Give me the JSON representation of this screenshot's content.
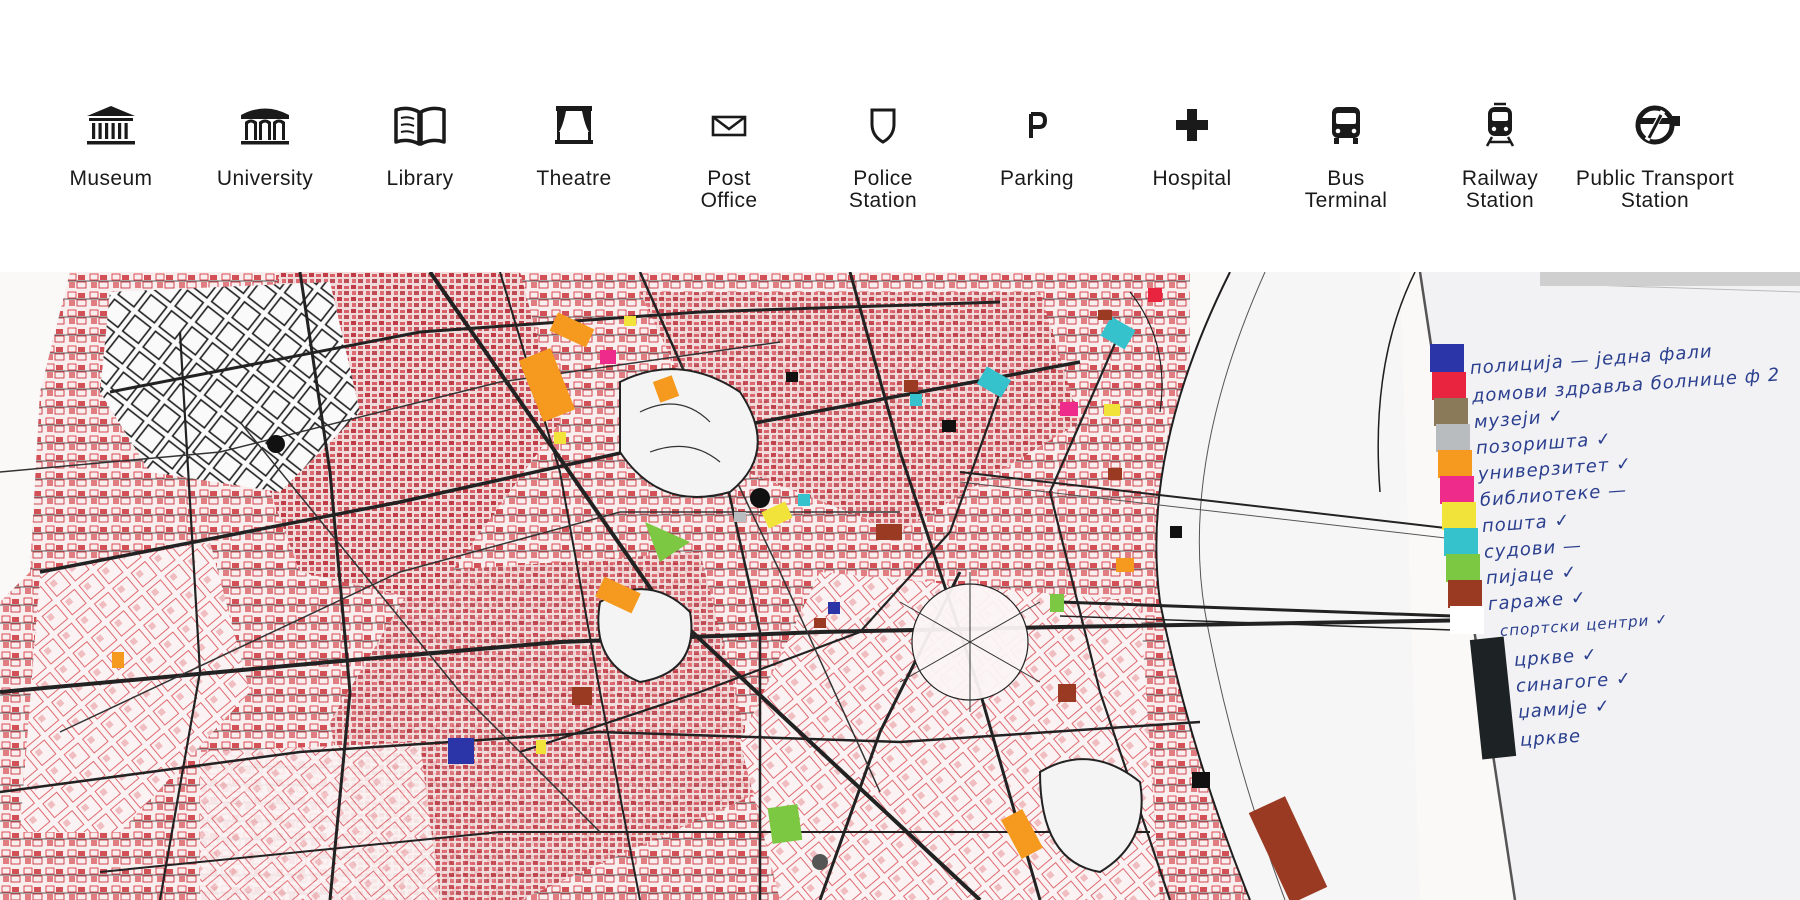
{
  "legend": {
    "items": [
      {
        "id": "museum",
        "icon": "museum-icon",
        "label": "Museum"
      },
      {
        "id": "university",
        "icon": "university-icon",
        "label": "University"
      },
      {
        "id": "library",
        "icon": "library-book-icon",
        "label": "Library"
      },
      {
        "id": "theatre",
        "icon": "theatre-curtain-icon",
        "label": "Theatre"
      },
      {
        "id": "post-office",
        "icon": "envelope-icon",
        "label": "Post\nOffice"
      },
      {
        "id": "police-station",
        "icon": "shield-icon",
        "label": "Police\nStation"
      },
      {
        "id": "parking",
        "icon": "parking-p-icon",
        "label": "Parking"
      },
      {
        "id": "hospital",
        "icon": "cross-icon",
        "label": "Hospital"
      },
      {
        "id": "bus-terminal",
        "icon": "bus-icon",
        "label": "Bus\nTerminal"
      },
      {
        "id": "railway-station",
        "icon": "train-icon",
        "label": "Railway\nStation"
      },
      {
        "id": "public-transport-station",
        "icon": "public-transport-icon",
        "label": "Public Transport\nStation"
      }
    ]
  },
  "map": {
    "photo_note": {
      "entries": [
        {
          "label": "полиција",
          "mark": "— једна фали",
          "color": "#2b35a8"
        },
        {
          "label": "домови здравља болнице",
          "mark": "ф 2",
          "color": "#e8243f"
        },
        {
          "label": "музеји",
          "mark": "✓",
          "color": "#8b7a5a"
        },
        {
          "label": "позоришта",
          "mark": "✓",
          "color": "#b9bcbf"
        },
        {
          "label": "универзитет",
          "mark": "✓",
          "color": "#f59a1e"
        },
        {
          "label": "библиотеке",
          "mark": "—",
          "color": "#ee2a8a"
        },
        {
          "label": "пошта",
          "mark": "✓",
          "color": "#f2e33a"
        },
        {
          "label": "судови",
          "mark": "—",
          "color": "#35c2cc"
        },
        {
          "label": "пијаце",
          "mark": "✓",
          "color": "#7cc843"
        },
        {
          "label": "гараже",
          "mark": "✓",
          "color": "#9a3a22"
        },
        {
          "label": "спортски центри",
          "mark": "✓",
          "color": "#ffffff"
        },
        {
          "label": "цркве",
          "mark": "✓",
          "color": "#1d2224"
        },
        {
          "label": "синагоге",
          "mark": "✓",
          "color": "#1d2224"
        },
        {
          "label": "џамије",
          "mark": "✓",
          "color": "#1d2224"
        },
        {
          "label": "цркве",
          "mark": "",
          "color": "#1d2224"
        }
      ]
    }
  }
}
